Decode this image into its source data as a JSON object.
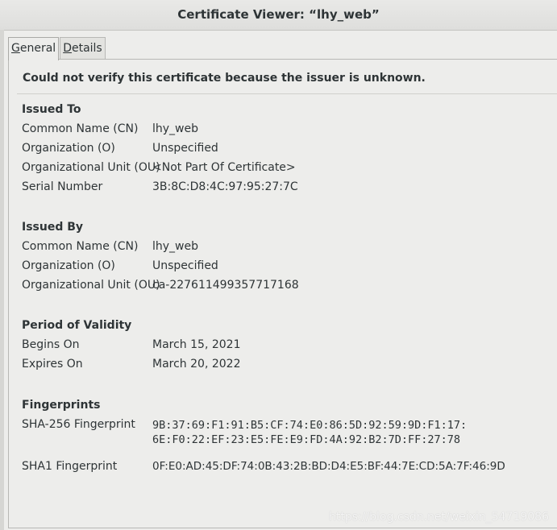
{
  "window": {
    "title": "Certificate Viewer: “lhy_web”"
  },
  "tabs": [
    {
      "label": "General",
      "mnemonic": "G"
    },
    {
      "label": "Details",
      "mnemonic": "D"
    }
  ],
  "general": {
    "warning": "Could not verify this certificate because the issuer is unknown.",
    "issued_to": {
      "title": "Issued To",
      "rows": [
        {
          "label": "Common Name (CN)",
          "value": "lhy_web"
        },
        {
          "label": "Organization (O)",
          "value": "Unspecified"
        },
        {
          "label": "Organizational Unit (OU)",
          "value": "<Not Part Of Certificate>"
        },
        {
          "label": "Serial Number",
          "value": "3B:8C:D8:4C:97:95:27:7C"
        }
      ]
    },
    "issued_by": {
      "title": "Issued By",
      "rows": [
        {
          "label": "Common Name (CN)",
          "value": "lhy_web"
        },
        {
          "label": "Organization (O)",
          "value": "Unspecified"
        },
        {
          "label": "Organizational Unit (OU)",
          "value": "ca-227611499357717168"
        }
      ]
    },
    "validity": {
      "title": "Period of Validity",
      "rows": [
        {
          "label": "Begins On",
          "value": "March 15, 2021"
        },
        {
          "label": "Expires On",
          "value": "March 20, 2022"
        }
      ]
    },
    "fingerprints": {
      "title": "Fingerprints",
      "sha256": {
        "label": "SHA-256 Fingerprint",
        "line1": "9B:37:69:F1:91:B5:CF:74:E0:86:5D:92:59:9D:F1:17:",
        "line2": "6E:F0:22:EF:23:E5:FE:E9:FD:4A:92:B2:7D:FF:27:78"
      },
      "sha1": {
        "label": "SHA1 Fingerprint",
        "value": "0F:E0:AD:45:DF:74:0B:43:2B:BD:D4:E5:BF:44:7E:CD:5A:7F:46:9D"
      }
    }
  },
  "watermark": "https://blog.csdn.net/weixin_54719086"
}
